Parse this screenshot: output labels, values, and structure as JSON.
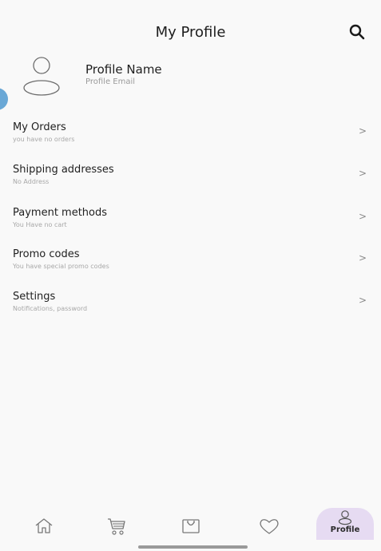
{
  "header": {
    "title": "My Profile"
  },
  "profile": {
    "name": "Profile Name",
    "email": "Profile Email"
  },
  "menu": [
    {
      "title": "My Orders",
      "subtitle": "you have no orders",
      "chevron": ">"
    },
    {
      "title": "Shipping addresses",
      "subtitle": "No Address",
      "chevron": ">"
    },
    {
      "title": "Payment methods",
      "subtitle": "You Have no cart",
      "chevron": ">"
    },
    {
      "title": "Promo codes",
      "subtitle": "You have special promo codes",
      "chevron": ">"
    },
    {
      "title": "Settings",
      "subtitle": "Notifications, password",
      "chevron": ">"
    }
  ],
  "bottom_nav": {
    "items": [
      {
        "icon": "home-icon"
      },
      {
        "icon": "cart-icon"
      },
      {
        "icon": "shopping-bag-icon"
      },
      {
        "icon": "heart-icon"
      },
      {
        "icon": "profile-icon",
        "label": "Profile",
        "active": true
      }
    ]
  },
  "colors": {
    "background": "#f9f9f9",
    "active_tab": "#e6dbf2",
    "edge_handle": "#6aa8d6"
  }
}
